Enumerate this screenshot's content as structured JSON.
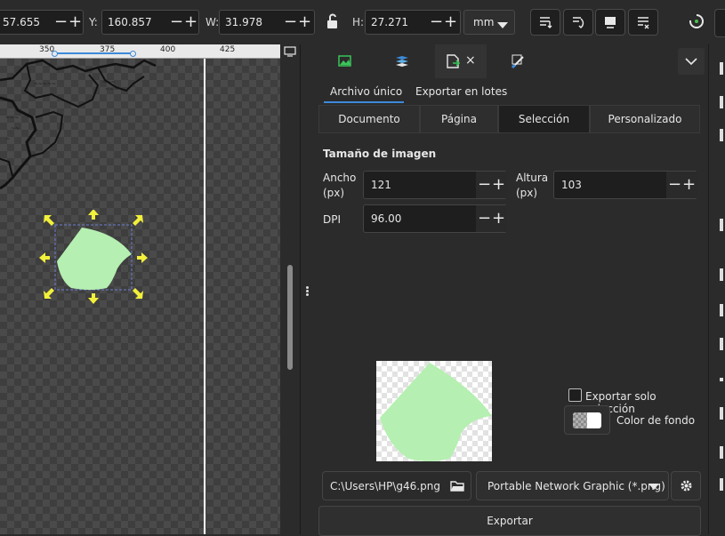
{
  "toolbar": {
    "x_value": "57.655",
    "y_label": "Y:",
    "y_value": "160.857",
    "w_label": "W:",
    "w_value": "31.978",
    "h_label": "H:",
    "h_value": "27.271",
    "units": "mm",
    "minus": "−",
    "plus": "+"
  },
  "ruler": {
    "ticks": [
      "350",
      "375",
      "400",
      "425"
    ]
  },
  "panel": {
    "subtabs": [
      "Archivo único",
      "Exportar en lotes"
    ],
    "segments": [
      "Documento",
      "Página",
      "Selección",
      "Personalizado"
    ],
    "section_title": "Tamaño de imagen",
    "width_label_1": "Ancho",
    "width_label_2": "(px)",
    "width_value": "121",
    "height_label_1": "Altura",
    "height_label_2": "(px)",
    "height_value": "103",
    "dpi_label": "DPI",
    "dpi_value": "96.00",
    "only_selection_label": "Exportar solo selección",
    "bg_color_label": "Color de fondo",
    "filename": "C:\\Users\\HP\\g46.png",
    "format": "Portable Network Graphic (*.png)",
    "export_label": "Exportar"
  },
  "colors": {
    "shape_fill": "#b5efb1",
    "accent": "#3d8ad9",
    "handle": "#f2f03a"
  }
}
